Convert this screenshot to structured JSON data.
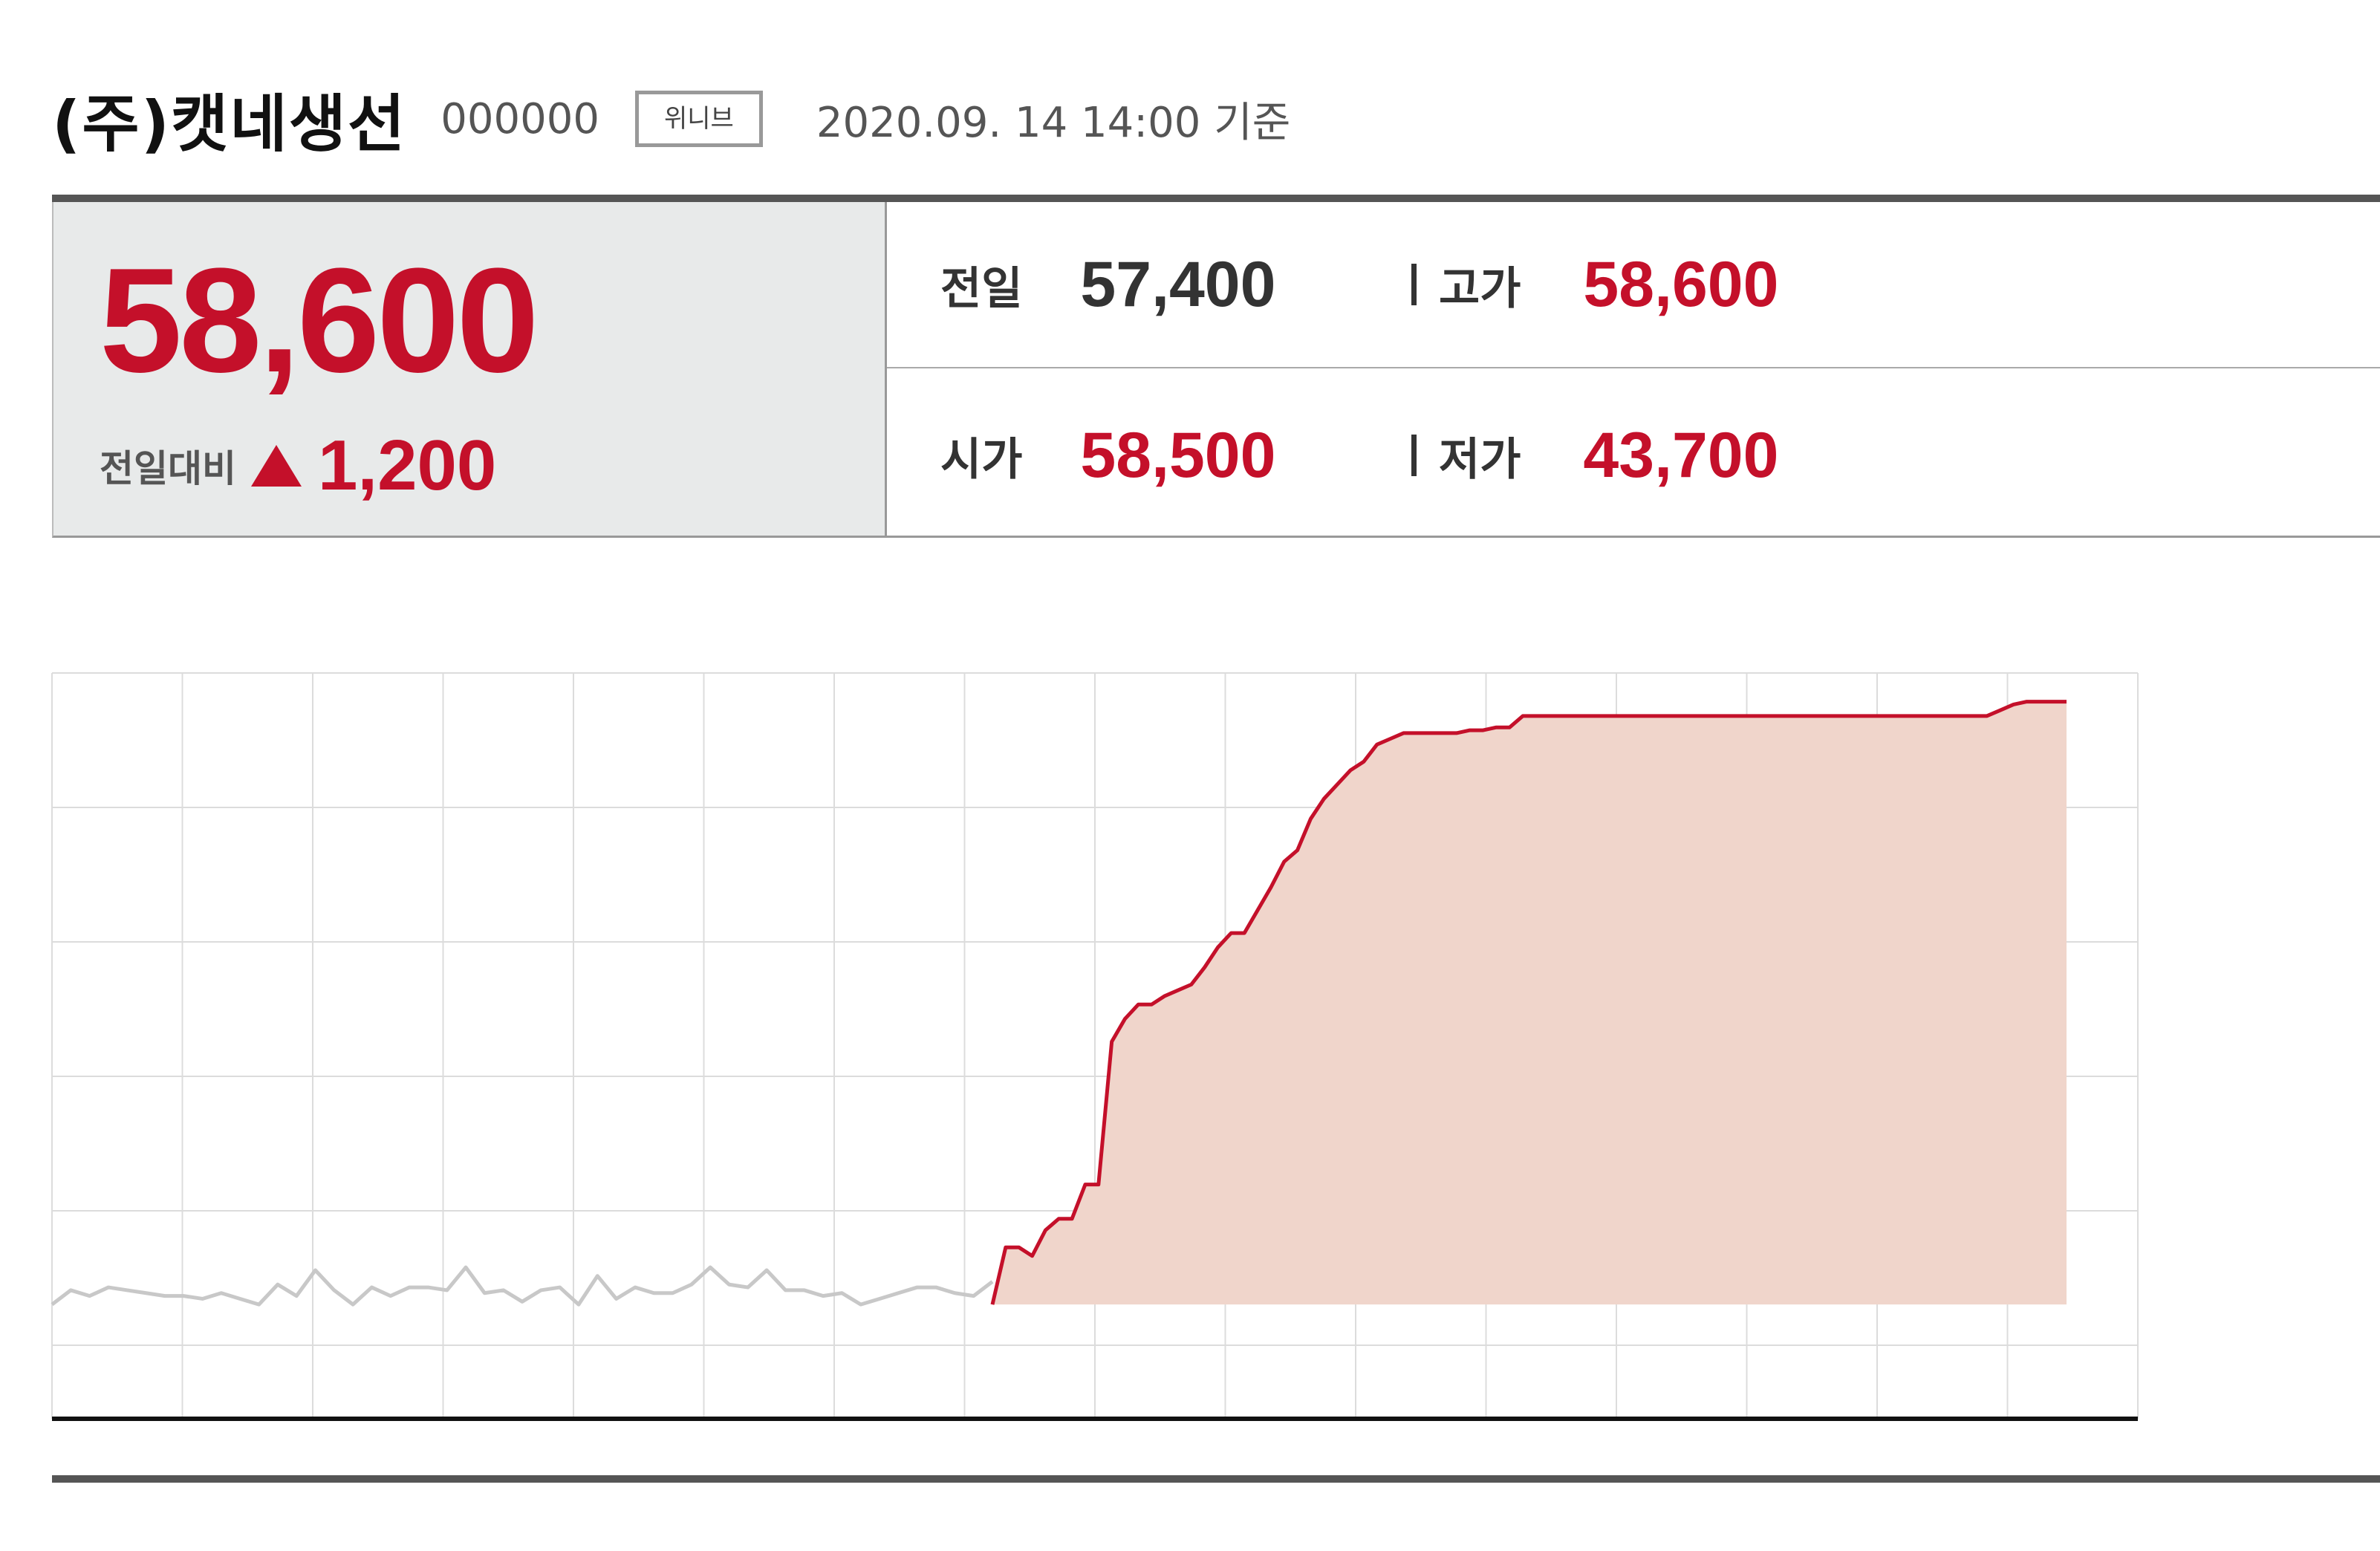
{
  "header": {
    "company": "(주)캣네생선",
    "code": "000000",
    "market": "위니브",
    "asof": "2020.09. 14   14:00 기준"
  },
  "price": {
    "current": "58,600",
    "change_label": "전일대비",
    "change_value": "1,200",
    "direction": "up"
  },
  "stats": {
    "prev_label": "전일",
    "prev_value": "57,400",
    "high_label": "고가",
    "high_value": "58,600",
    "open_label": "시가",
    "open_value": "58,500",
    "low_label": "저가",
    "low_value": "43,700"
  },
  "colors": {
    "up": "#c4102a",
    "line_gray": "#c8c8c8",
    "fill": "#f0d5cb",
    "grid": "#dcdcdc"
  },
  "chart_data": {
    "type": "area",
    "grid": true,
    "gray_series": [
      40,
      45,
      43,
      46,
      45,
      44,
      43,
      43,
      42,
      44,
      42,
      40,
      47,
      43,
      52,
      45,
      40,
      46,
      43,
      46,
      46,
      45,
      53,
      44,
      45,
      41,
      45,
      46,
      40,
      50,
      42,
      46,
      44,
      44,
      47,
      53,
      47,
      46,
      52,
      45,
      45,
      43,
      44,
      40,
      42,
      44,
      46,
      46,
      44,
      43,
      48
    ],
    "red_series": [
      40,
      60,
      60,
      57,
      66,
      70,
      70,
      82,
      82,
      132,
      140,
      145,
      145,
      148,
      150,
      152,
      158,
      165,
      170,
      170,
      178,
      186,
      195,
      199,
      210,
      217,
      222,
      227,
      230,
      236,
      238,
      240,
      240,
      240,
      240,
      240,
      241,
      241,
      242,
      242,
      246,
      246,
      246,
      246,
      246,
      246,
      246,
      246,
      246,
      246,
      246,
      246,
      246,
      246,
      246,
      246,
      246,
      246,
      246,
      246,
      246,
      246,
      246,
      246,
      246,
      246,
      246,
      246,
      246,
      246,
      246,
      246,
      246,
      246,
      246,
      246,
      248,
      250,
      251,
      251,
      251,
      251
    ]
  }
}
